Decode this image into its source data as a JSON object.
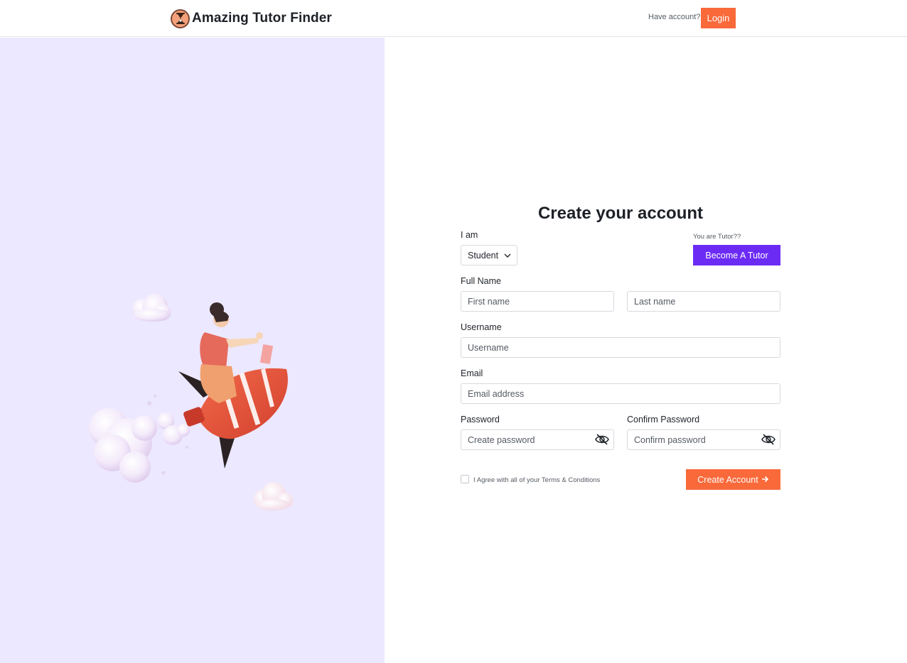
{
  "header": {
    "brand_name": "Amazing Tutor Finder",
    "have_account": "Have account?",
    "login_label": "Login"
  },
  "form": {
    "title": "Create your account",
    "role_label": "I am",
    "role_value": "Student",
    "tutor_prompt": "You are Tutor??",
    "become_tutor_label": "Become A Tutor",
    "full_name_label": "Full Name",
    "first_name_placeholder": "First name",
    "last_name_placeholder": "Last name",
    "username_label": "Username",
    "username_placeholder": "Username",
    "email_label": "Email",
    "email_placeholder": "Email address",
    "password_label": "Password",
    "password_placeholder": "Create password",
    "confirm_label": "Confirm Password",
    "confirm_placeholder": "Confirm password",
    "agree_text": "I Agree with all of your Terms & Conditions",
    "create_label": "Create Account"
  },
  "colors": {
    "accent_orange": "#f9693a",
    "accent_purple": "#6c2bf5",
    "left_panel_bg": "#ece8ff"
  },
  "icons": {
    "logo": "hourglass-logo-icon",
    "dropdown": "chevron-down-icon",
    "password_toggle": "eye-off-icon",
    "create_arrow": "arrow-right-icon"
  }
}
